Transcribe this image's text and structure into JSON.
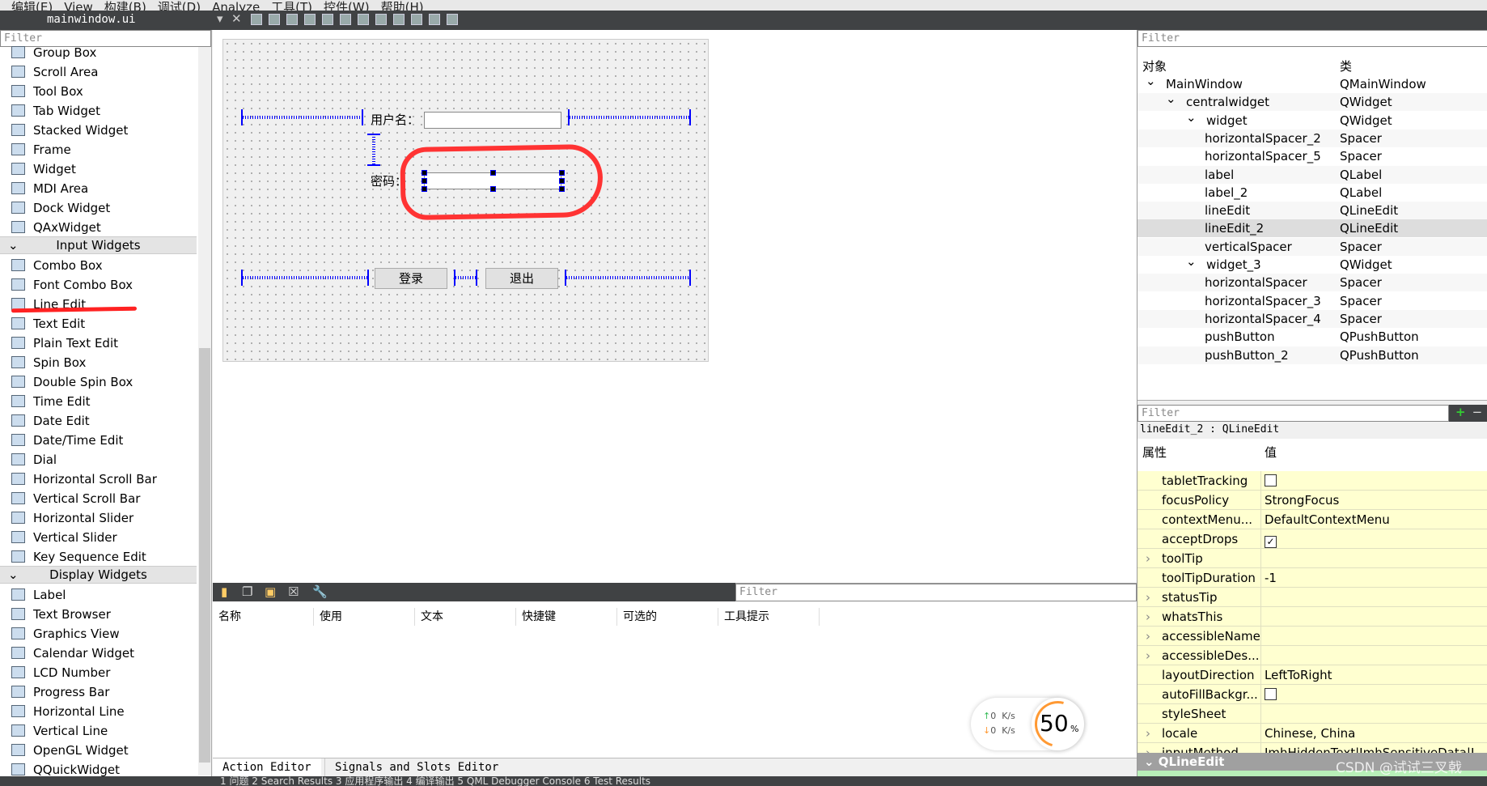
{
  "menu": [
    "编辑(E)",
    "View",
    "构建(B)",
    "调试(D)",
    "Analyze",
    "工具(T)",
    "控件(W)",
    "帮助(H)"
  ],
  "toolbar": {
    "file": "mainwindow.ui"
  },
  "widgetbox": {
    "filter_placeholder": "Filter",
    "items_top": [
      "Group Box",
      "Scroll Area",
      "Tool Box",
      "Tab Widget",
      "Stacked Widget",
      "Frame",
      "Widget",
      "MDI Area",
      "Dock Widget",
      "QAxWidget"
    ],
    "cat_input": "Input Widgets",
    "items_input": [
      "Combo Box",
      "Font Combo Box",
      "Line Edit",
      "Text Edit",
      "Plain Text Edit",
      "Spin Box",
      "Double Spin Box",
      "Time Edit",
      "Date Edit",
      "Date/Time Edit",
      "Dial",
      "Horizontal Scroll Bar",
      "Vertical Scroll Bar",
      "Horizontal Slider",
      "Vertical Slider",
      "Key Sequence Edit"
    ],
    "cat_display": "Display Widgets",
    "items_display": [
      "Label",
      "Text Browser",
      "Graphics View",
      "Calendar Widget",
      "LCD Number",
      "Progress Bar",
      "Horizontal Line",
      "Vertical Line",
      "OpenGL Widget",
      "QQuickWidget"
    ]
  },
  "form": {
    "username_label": "用户名：",
    "password_label": "密码：",
    "login_button": "登录",
    "exit_button": "退出"
  },
  "action_editor": {
    "filter_placeholder": "Filter",
    "columns": [
      "名称",
      "使用",
      "文本",
      "快捷键",
      "可选的",
      "工具提示"
    ]
  },
  "tabs": [
    "Action Editor",
    "Signals and Slots Editor"
  ],
  "status": "1 问题  2 Search Results  3 应用程序输出  4 编译输出  5 QML Debugger Console  6 Test Results",
  "network": {
    "up": "0",
    "down": "0",
    "unit": "K/s",
    "percent": "50",
    "percent_sign": "%"
  },
  "objects": {
    "filter_placeholder": "Filter",
    "col_object": "对象",
    "col_class": "类",
    "rows": [
      {
        "name": "MainWindow",
        "cls": "QMainWindow",
        "level": 0,
        "exp": "v"
      },
      {
        "name": "centralwidget",
        "cls": "QWidget",
        "level": 1,
        "exp": "v"
      },
      {
        "name": "widget",
        "cls": "QWidget",
        "level": 2,
        "exp": "v"
      },
      {
        "name": "horizontalSpacer_2",
        "cls": "Spacer",
        "level": 3
      },
      {
        "name": "horizontalSpacer_5",
        "cls": "Spacer",
        "level": 3
      },
      {
        "name": "label",
        "cls": "QLabel",
        "level": 3
      },
      {
        "name": "label_2",
        "cls": "QLabel",
        "level": 3
      },
      {
        "name": "lineEdit",
        "cls": "QLineEdit",
        "level": 3
      },
      {
        "name": "lineEdit_2",
        "cls": "QLineEdit",
        "level": 3,
        "selected": true
      },
      {
        "name": "verticalSpacer",
        "cls": "Spacer",
        "level": 3
      },
      {
        "name": "widget_3",
        "cls": "QWidget",
        "level": 2,
        "exp": "v"
      },
      {
        "name": "horizontalSpacer",
        "cls": "Spacer",
        "level": 3
      },
      {
        "name": "horizontalSpacer_3",
        "cls": "Spacer",
        "level": 3
      },
      {
        "name": "horizontalSpacer_4",
        "cls": "Spacer",
        "level": 3
      },
      {
        "name": "pushButton",
        "cls": "QPushButton",
        "level": 3
      },
      {
        "name": "pushButton_2",
        "cls": "QPushButton",
        "level": 3
      }
    ]
  },
  "properties": {
    "filter_placeholder": "Filter",
    "title": "lineEdit_2 : QLineEdit",
    "col_prop": "属性",
    "col_value": "值",
    "rows": [
      {
        "name": "tabletTracking",
        "check": false
      },
      {
        "name": "focusPolicy",
        "value": "StrongFocus"
      },
      {
        "name": "contextMenu...",
        "value": "DefaultContextMenu"
      },
      {
        "name": "acceptDrops",
        "check": true
      },
      {
        "name": "toolTip",
        "value": "",
        "exp": true
      },
      {
        "name": "toolTipDuration",
        "value": "-1"
      },
      {
        "name": "statusTip",
        "value": "",
        "exp": true
      },
      {
        "name": "whatsThis",
        "value": "",
        "exp": true
      },
      {
        "name": "accessibleName",
        "value": "",
        "exp": true
      },
      {
        "name": "accessibleDes...",
        "value": "",
        "exp": true
      },
      {
        "name": "layoutDirection",
        "value": "LeftToRight"
      },
      {
        "name": "autoFillBackgr...",
        "check": false
      },
      {
        "name": "styleSheet",
        "value": ""
      },
      {
        "name": "locale",
        "value": "Chinese, China",
        "exp": true
      },
      {
        "name": "inputMethod...",
        "value": "ImhHiddenText|ImhSensitiveData|I...",
        "exp": true
      }
    ],
    "section": "QLineEdit"
  },
  "watermark": "CSDN @试试三叉戟"
}
